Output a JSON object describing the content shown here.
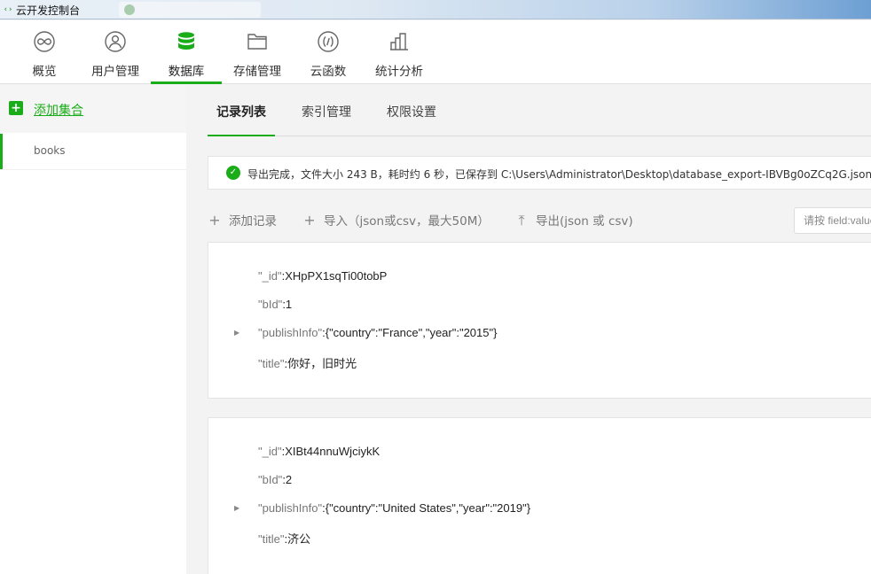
{
  "window": {
    "title": "云开发控制台",
    "icon_text": "‹›"
  },
  "nav": [
    {
      "label": "概览",
      "icon": "infinity-icon"
    },
    {
      "label": "用户管理",
      "icon": "user-icon"
    },
    {
      "label": "数据库",
      "icon": "database-icon",
      "active": true
    },
    {
      "label": "存储管理",
      "icon": "folder-icon"
    },
    {
      "label": "云函数",
      "icon": "function-icon"
    },
    {
      "label": "统计分析",
      "icon": "bar-chart-icon"
    }
  ],
  "sidebar": {
    "add_label": "添加集合",
    "collections": [
      "books"
    ]
  },
  "tabs": [
    {
      "label": "记录列表",
      "active": true
    },
    {
      "label": "索引管理"
    },
    {
      "label": "权限设置"
    }
  ],
  "notice": {
    "message": "导出完成，文件大小 243 B，耗时约 6 秒，已保存到 C:\\Users\\Administrator\\Desktop\\database_export-IBVBg0oZCq2G.json"
  },
  "toolbar": {
    "add_record": "添加记录",
    "import": "导入（json或csv，最大50M）",
    "export": "导出(json 或 csv)",
    "search_placeholder": "请按 field:value"
  },
  "records": [
    {
      "fields": [
        {
          "key": "\"_id\"",
          "value": ":XHpPX1sqTi00tobP",
          "expandable": false
        },
        {
          "key": "\"bId\"",
          "value": ":1",
          "expandable": false
        },
        {
          "key": "\"publishInfo\"",
          "value": ":{\"country\":\"France\",\"year\":\"2015\"}",
          "expandable": true
        },
        {
          "key": "\"title\"",
          "value": ":你好，旧时光",
          "expandable": false
        }
      ]
    },
    {
      "fields": [
        {
          "key": "\"_id\"",
          "value": ":XIBt44nnuWjciykK",
          "expandable": false
        },
        {
          "key": "\"bId\"",
          "value": ":2",
          "expandable": false
        },
        {
          "key": "\"publishInfo\"",
          "value": ":{\"country\":\"United States\",\"year\":\"2019\"}",
          "expandable": true
        },
        {
          "key": "\"title\"",
          "value": ":济公",
          "expandable": false
        }
      ]
    }
  ],
  "colors": {
    "accent": "#1aad19"
  }
}
